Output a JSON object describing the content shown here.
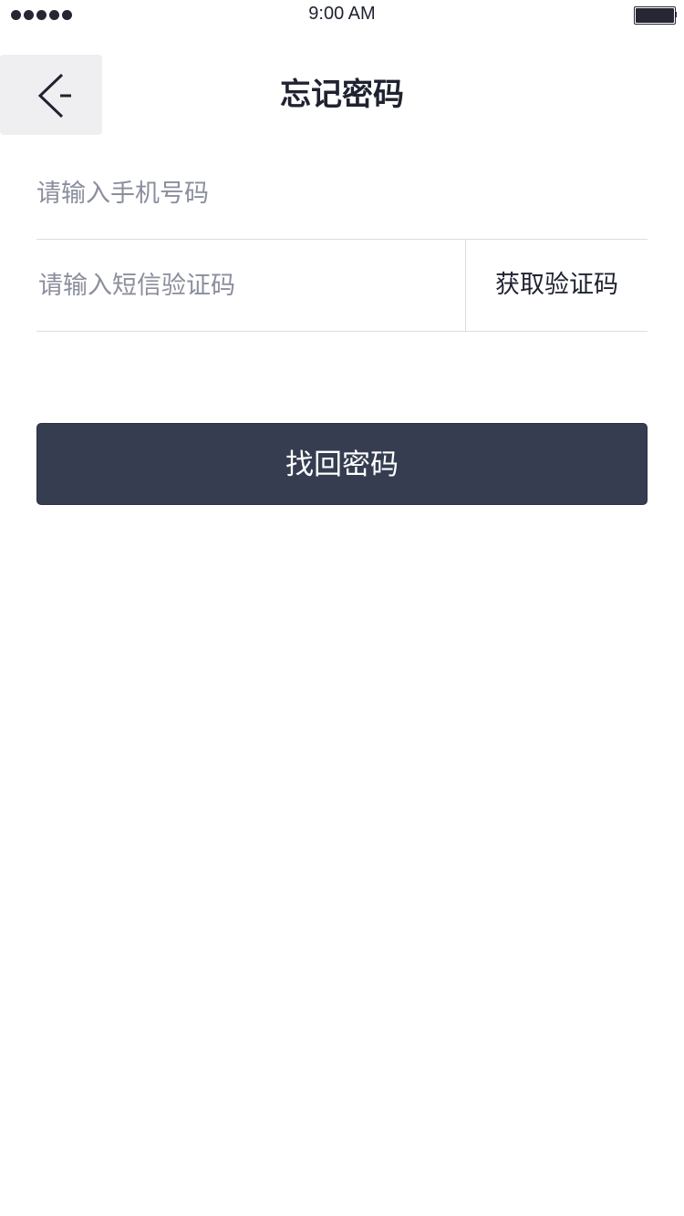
{
  "status_bar": {
    "time": "9:00 AM",
    "signal_icon": "signal-dots-icon",
    "battery_icon": "battery-icon"
  },
  "nav": {
    "title": "忘记密码",
    "back_icon": "back-arrow-icon"
  },
  "form": {
    "phone_placeholder": "请输入手机号码",
    "code_placeholder": "请输入短信验证码",
    "get_code_label": "获取验证码"
  },
  "submit": {
    "label": "找回密码"
  },
  "colors": {
    "button_bg": "#363d51",
    "back_bg": "#efeff1",
    "divider": "#dddde0",
    "placeholder": "#8b8e9c"
  }
}
